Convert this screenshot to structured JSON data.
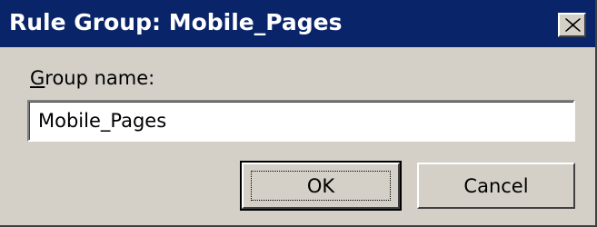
{
  "window": {
    "title": "Rule Group:  Mobile_Pages",
    "close_icon": "close-x"
  },
  "form": {
    "label_accel": "G",
    "label_rest": "roup name:",
    "name_value": "Mobile_Pages"
  },
  "buttons": {
    "ok_label": "OK",
    "cancel_label": "Cancel"
  },
  "colors": {
    "titlebar": "#0a246a",
    "dialog_bg": "#d4d0c8"
  }
}
